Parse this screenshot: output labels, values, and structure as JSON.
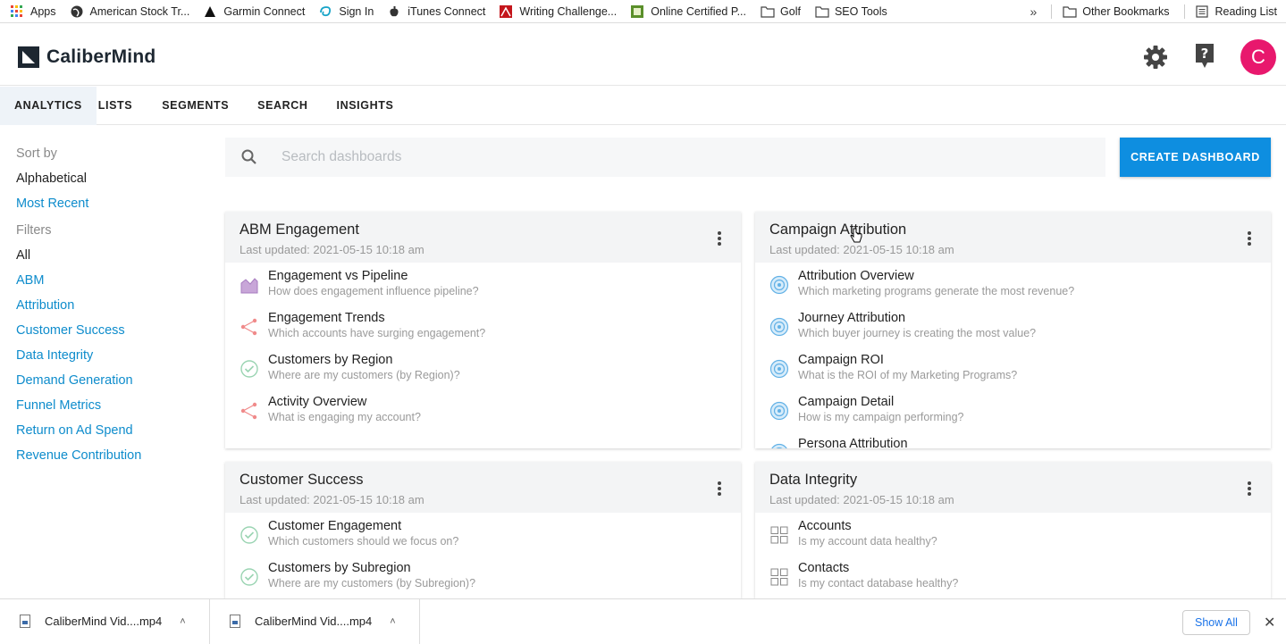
{
  "bookmarks": {
    "items": [
      {
        "label": "Apps",
        "icon": "apps-grid-icon"
      },
      {
        "label": "American Stock Tr...",
        "icon": "globe-icon"
      },
      {
        "label": "Garmin Connect",
        "icon": "triangle-icon"
      },
      {
        "label": "Sign In",
        "icon": "swirl-icon"
      },
      {
        "label": "iTunes Connect",
        "icon": "apple-icon"
      },
      {
        "label": "Writing Challenge...",
        "icon": "red-logo-icon"
      },
      {
        "label": "Online Certified P...",
        "icon": "green-logo-icon"
      },
      {
        "label": "Golf",
        "icon": "folder-icon"
      },
      {
        "label": "SEO Tools",
        "icon": "folder-icon"
      }
    ],
    "overflow": "»",
    "other": "Other Bookmarks",
    "reading_list": "Reading List"
  },
  "header": {
    "brand": "CaliberMind",
    "avatar_letter": "C"
  },
  "nav": {
    "tabs": [
      "ANALYTICS",
      "LISTS",
      "SEGMENTS",
      "SEARCH",
      "INSIGHTS"
    ],
    "active": "ANALYTICS"
  },
  "sidebar": {
    "sort_heading": "Sort by",
    "sort_options": [
      "Alphabetical",
      "Most Recent"
    ],
    "filters_heading": "Filters",
    "filters": [
      "All",
      "ABM",
      "Attribution",
      "Customer Success",
      "Data Integrity",
      "Demand Generation",
      "Funnel Metrics",
      "Return on Ad Spend",
      "Revenue Contribution"
    ]
  },
  "search": {
    "placeholder": "Search dashboards"
  },
  "create_button": "CREATE DASHBOARD",
  "cards": [
    {
      "title": "ABM Engagement",
      "updated": "Last updated: 2021-05-15 10:18 am",
      "items": [
        {
          "title": "Engagement vs Pipeline",
          "desc": "How does engagement influence pipeline?",
          "icon": "area-chart-icon"
        },
        {
          "title": "Engagement Trends",
          "desc": "Which accounts have surging engagement?",
          "icon": "network-icon"
        },
        {
          "title": "Customers by Region",
          "desc": "Where are my customers (by Region)?",
          "icon": "check-circle-icon"
        },
        {
          "title": "Activity Overview",
          "desc": "What is engaging my account?",
          "icon": "network-icon"
        }
      ]
    },
    {
      "title": "Campaign Attribution",
      "updated": "Last updated: 2021-05-15 10:18 am",
      "items": [
        {
          "title": "Attribution Overview",
          "desc": "Which marketing programs generate the most revenue?",
          "icon": "target-icon"
        },
        {
          "title": "Journey Attribution",
          "desc": "Which buyer journey is creating the most value?",
          "icon": "target-icon"
        },
        {
          "title": "Campaign ROI",
          "desc": "What is the ROI of my Marketing Programs?",
          "icon": "target-icon"
        },
        {
          "title": "Campaign Detail",
          "desc": "How is my campaign performing?",
          "icon": "target-icon"
        },
        {
          "title": "Persona Attribution",
          "desc": "",
          "icon": "target-icon"
        }
      ]
    },
    {
      "title": "Customer Success",
      "updated": "Last updated: 2021-05-15 10:18 am",
      "items": [
        {
          "title": "Customer Engagement",
          "desc": "Which customers should we focus on?",
          "icon": "check-circle-icon"
        },
        {
          "title": "Customers by Subregion",
          "desc": "Where are my customers (by Subregion)?",
          "icon": "check-circle-icon"
        }
      ]
    },
    {
      "title": "Data Integrity",
      "updated": "Last updated: 2021-05-15 10:18 am",
      "items": [
        {
          "title": "Accounts",
          "desc": "Is my account data healthy?",
          "icon": "grid-icon"
        },
        {
          "title": "Contacts",
          "desc": "Is my contact database healthy?",
          "icon": "grid-icon"
        }
      ]
    }
  ],
  "downloads": {
    "items": [
      "CaliberMind Vid....mp4",
      "CaliberMind Vid....mp4"
    ],
    "show_all": "Show All"
  },
  "colors": {
    "accent": "#0e8ee0",
    "link": "#0e8ccc",
    "avatar": "#e8186d"
  }
}
